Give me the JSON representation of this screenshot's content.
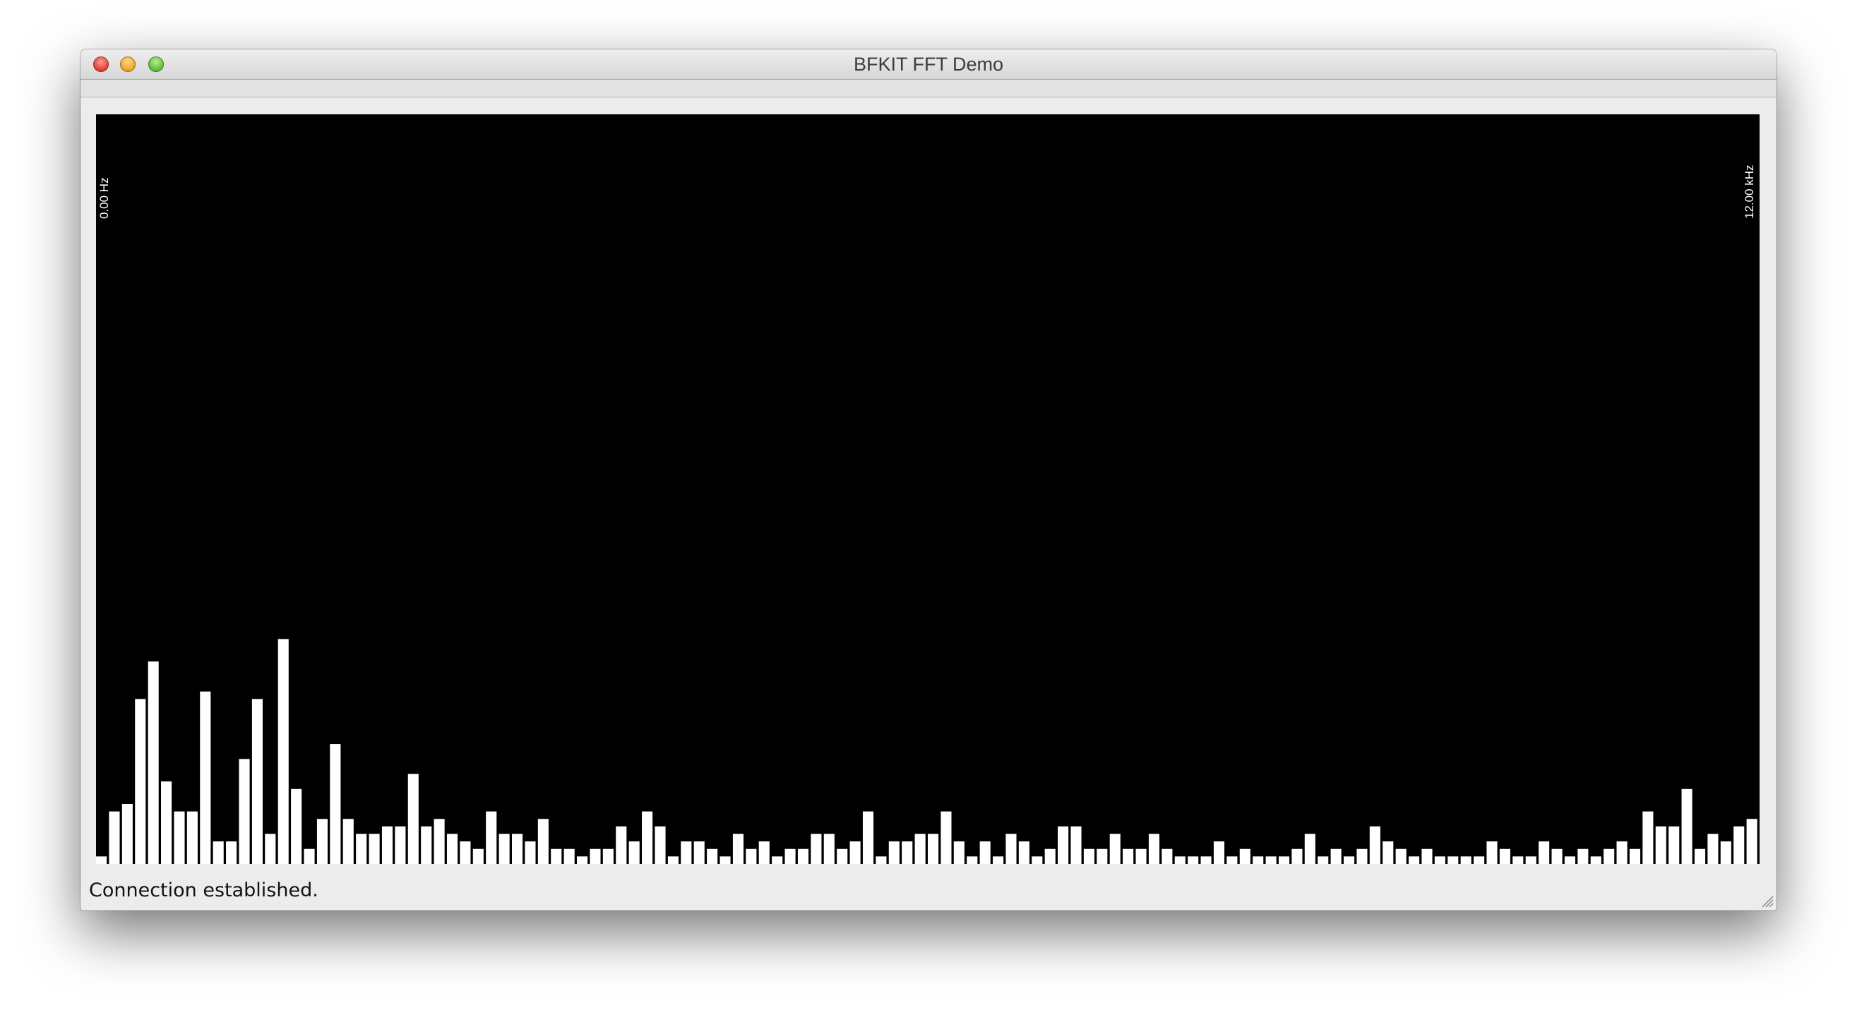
{
  "window": {
    "title": "BFKIT FFT Demo"
  },
  "spectrum": {
    "min_label": "0.00 Hz",
    "max_label": "12.00 kHz",
    "bar_color": "#ffffff",
    "background_color": "#000000"
  },
  "status": {
    "text": "Connection established."
  },
  "chart_data": {
    "type": "bar",
    "title": "",
    "xlabel": "",
    "ylabel": "",
    "ylim": [
      0,
      1
    ],
    "values": [
      0.01,
      0.07,
      0.08,
      0.22,
      0.27,
      0.11,
      0.07,
      0.07,
      0.23,
      0.03,
      0.03,
      0.14,
      0.22,
      0.04,
      0.3,
      0.1,
      0.02,
      0.06,
      0.16,
      0.06,
      0.04,
      0.04,
      0.05,
      0.05,
      0.12,
      0.05,
      0.06,
      0.04,
      0.03,
      0.02,
      0.07,
      0.04,
      0.04,
      0.03,
      0.06,
      0.02,
      0.02,
      0.01,
      0.02,
      0.02,
      0.05,
      0.03,
      0.07,
      0.05,
      0.01,
      0.03,
      0.03,
      0.02,
      0.01,
      0.04,
      0.02,
      0.03,
      0.01,
      0.02,
      0.02,
      0.04,
      0.04,
      0.02,
      0.03,
      0.07,
      0.01,
      0.03,
      0.03,
      0.04,
      0.04,
      0.07,
      0.03,
      0.01,
      0.03,
      0.01,
      0.04,
      0.03,
      0.01,
      0.02,
      0.05,
      0.05,
      0.02,
      0.02,
      0.04,
      0.02,
      0.02,
      0.04,
      0.02,
      0.01,
      0.01,
      0.01,
      0.03,
      0.01,
      0.02,
      0.01,
      0.01,
      0.01,
      0.02,
      0.04,
      0.01,
      0.02,
      0.01,
      0.02,
      0.05,
      0.03,
      0.02,
      0.01,
      0.02,
      0.01,
      0.01,
      0.01,
      0.01,
      0.03,
      0.02,
      0.01,
      0.01,
      0.03,
      0.02,
      0.01,
      0.02,
      0.01,
      0.02,
      0.03,
      0.02,
      0.07,
      0.05,
      0.05,
      0.1,
      0.02,
      0.04,
      0.03,
      0.05,
      0.06
    ]
  }
}
